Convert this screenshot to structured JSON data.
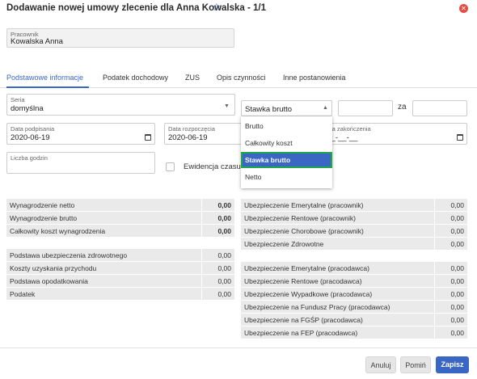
{
  "header": {
    "title": "Dodawanie nowej umowy zlecenie dla Anna Kowalska - 1/1"
  },
  "employee": {
    "label": "Pracownik",
    "value": "Kowalska Anna"
  },
  "tabs": [
    {
      "label": "Podstawowe informacje",
      "active": true
    },
    {
      "label": "Podatek dochodowy"
    },
    {
      "label": "ZUS"
    },
    {
      "label": "Opis czynności"
    },
    {
      "label": "Inne postanowienia"
    }
  ],
  "form": {
    "seria": {
      "label": "Seria",
      "value": "domyślna"
    },
    "rate_type": {
      "value": "Stawka brutto"
    },
    "za_label": "za",
    "data_podpisania": {
      "label": "Data podpisania",
      "value": "2020-06-19"
    },
    "data_rozpoczecia": {
      "label": "Data rozpoczęcia",
      "value": "2020-06-19"
    },
    "data_zakonczenia": {
      "label": "Data zakończenia",
      "value": "___-__-__"
    },
    "liczba_godzin": {
      "label": "Liczba godzin"
    },
    "ewidencja": {
      "label": "Ewidencja czasu",
      "checked": false
    }
  },
  "dropdown": {
    "options": [
      "Brutto",
      "Całkowity koszt",
      "Stawka brutto",
      "Netto"
    ],
    "selected": "Stawka brutto"
  },
  "summary_left": {
    "group1": [
      {
        "label": "Wynagrodzenie netto",
        "value": "0,00"
      },
      {
        "label": "Wynagrodzenie brutto",
        "value": "0,00"
      },
      {
        "label": "Całkowity koszt wynagrodzenia",
        "value": "0,00"
      }
    ],
    "group2": [
      {
        "label": "Podstawa ubezpieczenia zdrowotnego",
        "value": "0,00"
      },
      {
        "label": "Koszty uzyskania przychodu",
        "value": "0,00"
      },
      {
        "label": "Podstawa opodatkowania",
        "value": "0,00"
      },
      {
        "label": "Podatek",
        "value": "0,00"
      }
    ]
  },
  "summary_right": {
    "group1": [
      {
        "label": "Ubezpieczenie Emerytalne (pracownik)",
        "value": "0,00"
      },
      {
        "label": "Ubezpieczenie Rentowe (pracownik)",
        "value": "0,00"
      },
      {
        "label": "Ubezpieczenie Chorobowe (pracownik)",
        "value": "0,00"
      },
      {
        "label": "Ubezpieczenie Zdrowotne",
        "value": "0,00"
      }
    ],
    "group2": [
      {
        "label": "Ubezpieczenie Emerytalne (pracodawca)",
        "value": "0,00"
      },
      {
        "label": "Ubezpieczenie Rentowe (pracodawca)",
        "value": "0,00"
      },
      {
        "label": "Ubezpieczenie Wypadkowe (pracodawca)",
        "value": "0,00"
      },
      {
        "label": "Ubezpieczenie na Fundusz Pracy (pracodawca)",
        "value": "0,00"
      },
      {
        "label": "Ubezpieczenie na FGŚP (pracodawca)",
        "value": "0,00"
      },
      {
        "label": "Ubezpieczenie na FEP (pracodawca)",
        "value": "0,00"
      }
    ]
  },
  "buttons": {
    "cancel": "Anuluj",
    "skip": "Pomiń",
    "save": "Zapisz"
  },
  "colors": {
    "accent": "#3b67c4",
    "close": "#e24e42",
    "highlight": "#1fa849"
  },
  "icons": {
    "favorite": "star-outline-icon",
    "close": "close-circle-icon",
    "calendar": "calendar-icon"
  }
}
